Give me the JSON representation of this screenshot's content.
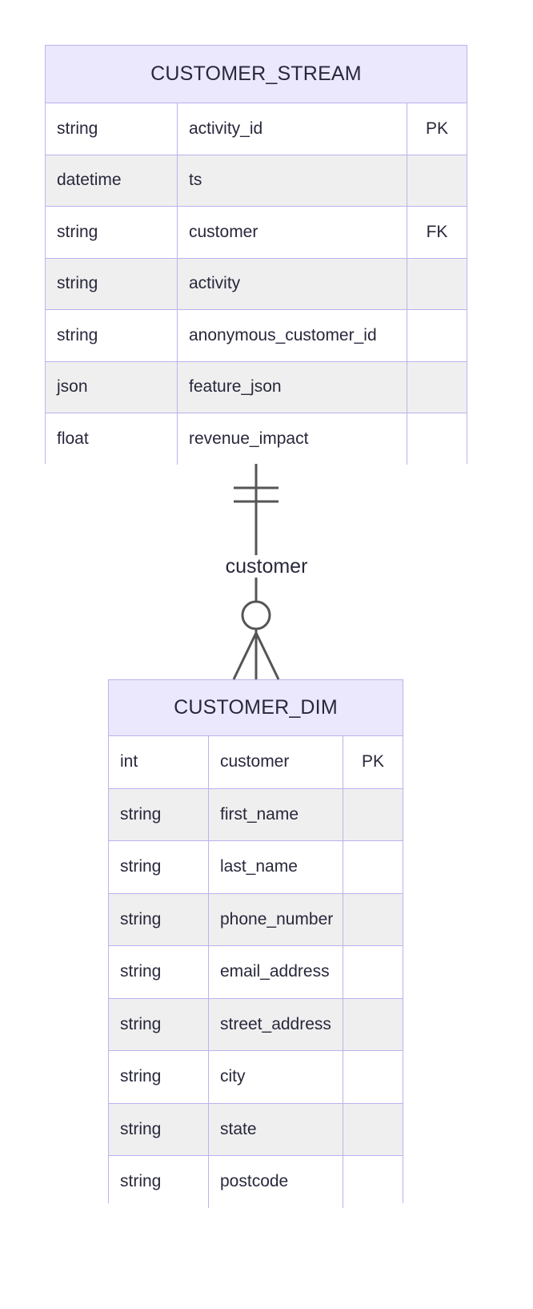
{
  "diagram": {
    "type": "entity-relationship-diagram",
    "notation": "crow's foot",
    "background_color": "#ffffff",
    "entity_border_color": "#b9b3ee",
    "entity_header_color": "#ebe8fd",
    "row_alt_color": "#efefef",
    "text_color": "#28283c",
    "connector_color": "#555555"
  },
  "entities": [
    {
      "id": "customer_stream",
      "name": "CUSTOMER_STREAM",
      "attributes": [
        {
          "type": "string",
          "name": "activity_id",
          "key": "PK"
        },
        {
          "type": "datetime",
          "name": "ts",
          "key": ""
        },
        {
          "type": "string",
          "name": "customer",
          "key": "FK"
        },
        {
          "type": "string",
          "name": "activity",
          "key": ""
        },
        {
          "type": "string",
          "name": "anonymous_customer_id",
          "key": ""
        },
        {
          "type": "json",
          "name": "feature_json",
          "key": ""
        },
        {
          "type": "float",
          "name": "revenue_impact",
          "key": ""
        }
      ]
    },
    {
      "id": "customer_dim",
      "name": "CUSTOMER_DIM",
      "attributes": [
        {
          "type": "int",
          "name": "customer",
          "key": "PK"
        },
        {
          "type": "string",
          "name": "first_name",
          "key": ""
        },
        {
          "type": "string",
          "name": "last_name",
          "key": ""
        },
        {
          "type": "string",
          "name": "phone_number",
          "key": ""
        },
        {
          "type": "string",
          "name": "email_address",
          "key": ""
        },
        {
          "type": "string",
          "name": "street_address",
          "key": ""
        },
        {
          "type": "string",
          "name": "city",
          "key": ""
        },
        {
          "type": "string",
          "name": "state",
          "key": ""
        },
        {
          "type": "string",
          "name": "postcode",
          "key": ""
        }
      ]
    }
  ],
  "relationships": [
    {
      "id": "rel-customer",
      "label": "customer",
      "from_entity": "CUSTOMER_STREAM",
      "to_entity": "CUSTOMER_DIM",
      "from_cardinality": "exactly-one",
      "to_cardinality": "zero-or-many"
    }
  ]
}
